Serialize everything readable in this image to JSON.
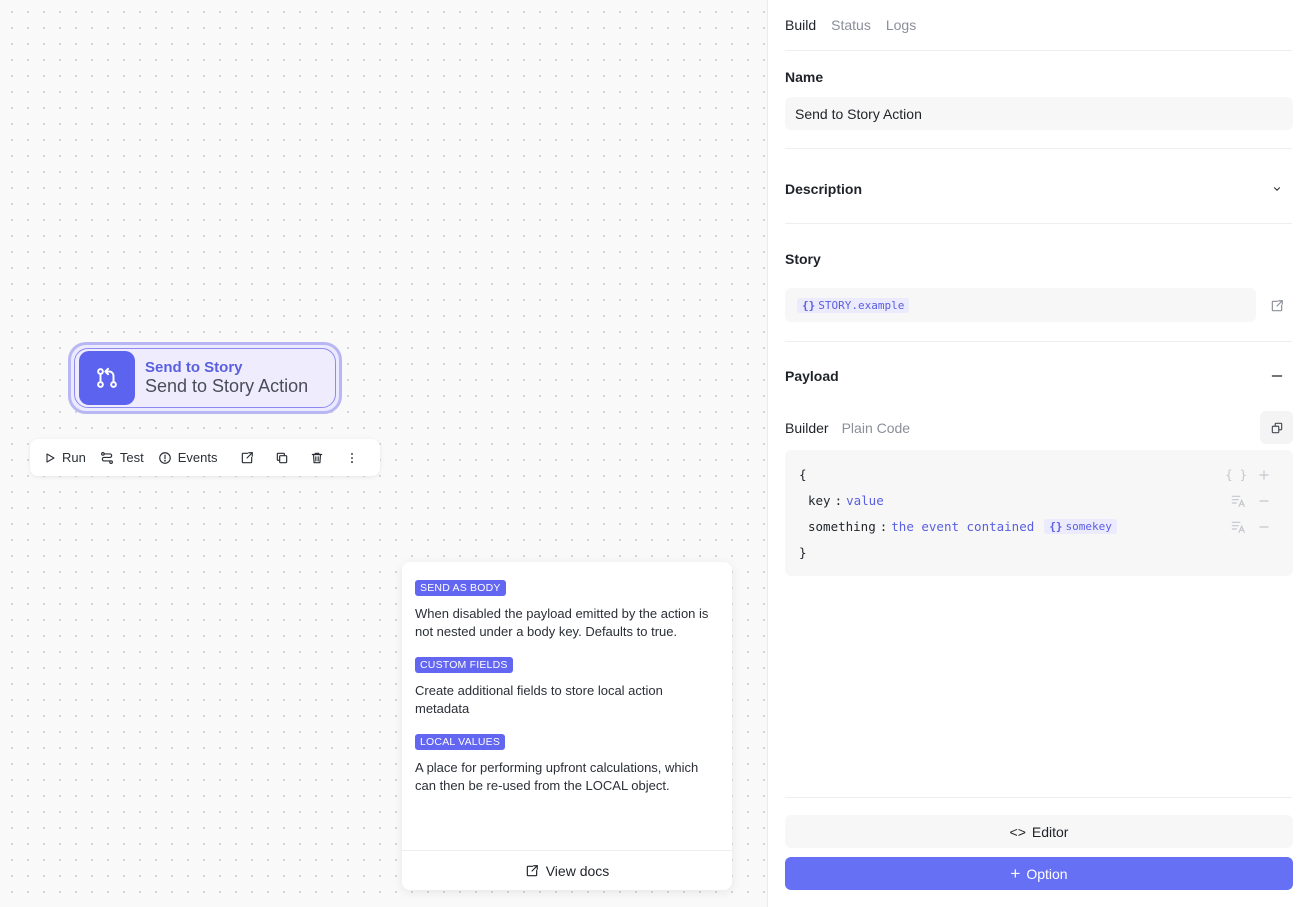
{
  "node": {
    "type_label": "Send to Story",
    "name": "Send to Story Action",
    "accent": "#5c64ef"
  },
  "toolbar": {
    "run_label": "Run",
    "test_label": "Test",
    "events_label": "Events"
  },
  "help": {
    "sections": [
      {
        "tag": "SEND AS BODY",
        "text": "When disabled the payload emitted by the action is not nested under a body key. Defaults to true."
      },
      {
        "tag": "CUSTOM FIELDS",
        "text": "Create additional fields to store local action metadata"
      },
      {
        "tag": "LOCAL VALUES",
        "text": "A place for performing upfront calculations, which can then be re-used from the LOCAL object."
      }
    ],
    "docs_label": "View docs"
  },
  "panel": {
    "tabs": [
      {
        "label": "Build",
        "active": true
      },
      {
        "label": "Status",
        "active": false
      },
      {
        "label": "Logs",
        "active": false
      }
    ],
    "name_label": "Name",
    "name_value": "Send to Story Action",
    "description_label": "Description",
    "story_label": "Story",
    "story_pill_icon": "{}",
    "story_value": "STORY.example",
    "payload_label": "Payload",
    "payload_tabs": [
      {
        "label": "Builder",
        "active": true
      },
      {
        "label": "Plain Code",
        "active": false
      }
    ],
    "code": {
      "open": "{",
      "close": "}",
      "rows": [
        {
          "key": "key",
          "value": "value"
        },
        {
          "key": "something",
          "value": "the event contained",
          "pill": "somekey"
        }
      ],
      "colon": ":"
    },
    "editor_label": "Editor",
    "editor_icon": "<>",
    "option_label": "Option",
    "option_icon": "+",
    "primary_color": "#6670f5"
  }
}
